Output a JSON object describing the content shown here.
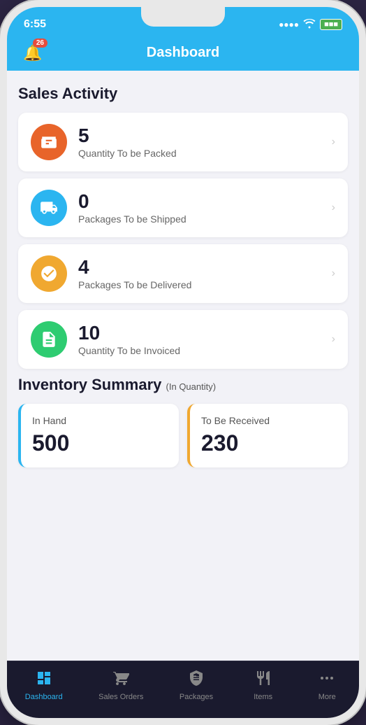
{
  "status": {
    "time": "6:55",
    "wifi": "wifi",
    "battery": "battery"
  },
  "header": {
    "title": "Dashboard",
    "notification_count": "26"
  },
  "sales_activity": {
    "section_title": "Sales Activity",
    "cards": [
      {
        "number": "5",
        "label": "Quantity To be Packed",
        "icon_type": "box",
        "icon_color": "orange"
      },
      {
        "number": "0",
        "label": "Packages To be Shipped",
        "icon_type": "truck",
        "icon_color": "blue"
      },
      {
        "number": "4",
        "label": "Packages To be Delivered",
        "icon_type": "check",
        "icon_color": "amber"
      },
      {
        "number": "10",
        "label": "Quantity To be Invoiced",
        "icon_type": "document",
        "icon_color": "green"
      }
    ]
  },
  "inventory_summary": {
    "section_title": "Inventory Summary",
    "subtitle": "(In Quantity)",
    "in_hand": {
      "label": "In Hand",
      "value": "500"
    },
    "to_be_received": {
      "label": "To Be Received",
      "value": "230"
    }
  },
  "bottom_nav": {
    "items": [
      {
        "label": "Dashboard",
        "active": true
      },
      {
        "label": "Sales Orders",
        "active": false
      },
      {
        "label": "Packages",
        "active": false
      },
      {
        "label": "Items",
        "active": false
      },
      {
        "label": "More",
        "active": false
      }
    ]
  }
}
